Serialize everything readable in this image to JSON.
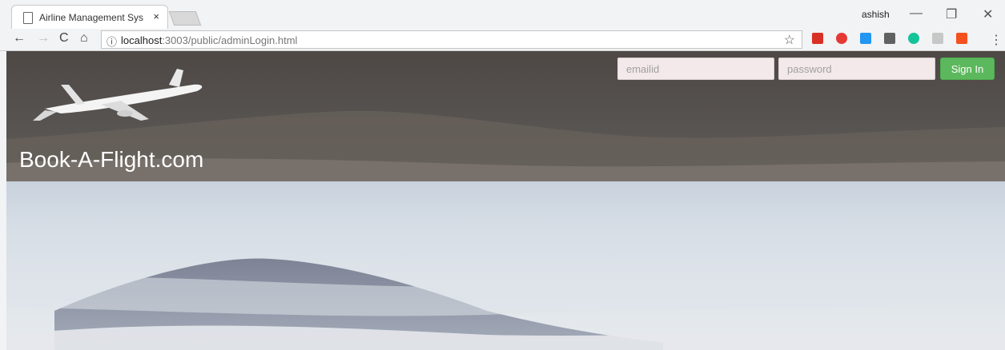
{
  "browser": {
    "tab_title": "Airline Management Syst",
    "tab_close": "×",
    "user": "ashish",
    "url_host": "localhost",
    "url_path": ":3003/public/adminLogin.html",
    "window_controls": {
      "minimize": "—",
      "maximize": "❐",
      "close": "✕"
    },
    "nav": {
      "back": "←",
      "forward": "→",
      "reload": "C",
      "home": "⌂"
    },
    "bookmark_star": "☆",
    "info_icon": "ⓘ",
    "menu": "⋮",
    "extensions": [
      {
        "name": "bookmark-extension-icon",
        "color": "#d93025"
      },
      {
        "name": "adblock-extension-icon",
        "color": "#e53935"
      },
      {
        "name": "window-extension-icon",
        "color": "#2196f3"
      },
      {
        "name": "screen-extension-icon",
        "color": "#616161"
      },
      {
        "name": "grammarly-extension-icon",
        "color": "#15c39a"
      },
      {
        "name": "link-extension-icon",
        "color": "#c7c7c7"
      },
      {
        "name": "color-extension-icon",
        "color": "#f4511e"
      }
    ]
  },
  "login": {
    "email_placeholder": "emailid",
    "password_placeholder": "password",
    "signin_label": "Sign In"
  },
  "brand": {
    "title": "Book-A-Flight.com"
  },
  "colors": {
    "signin": "#5cb85c",
    "header": "#524d4a",
    "field": "#f3e9ea"
  }
}
